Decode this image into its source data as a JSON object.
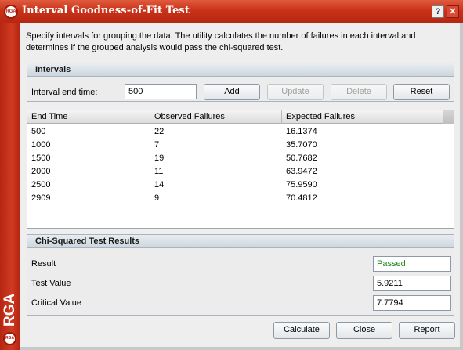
{
  "window": {
    "title": "Interval Goodness-of-Fit Test",
    "logo_text": "RGA",
    "help_label": "?",
    "close_label": "✕",
    "sidebar_brand": "RGA"
  },
  "description": "Specify intervals for grouping the data. The utility calculates the number of failures in each interval and determines if the grouped analysis would pass the chi-squared test.",
  "intervals": {
    "header": "Intervals",
    "end_time_label": "Interval end time:",
    "end_time_value": "500",
    "buttons": {
      "add": "Add",
      "update": "Update",
      "delete": "Delete",
      "reset": "Reset"
    }
  },
  "table": {
    "columns": [
      "End Time",
      "Observed Failures",
      "Expected Failures"
    ],
    "rows": [
      [
        "500",
        "22",
        "16.1374"
      ],
      [
        "1000",
        "7",
        "35.7070"
      ],
      [
        "1500",
        "19",
        "50.7682"
      ],
      [
        "2000",
        "11",
        "63.9472"
      ],
      [
        "2500",
        "14",
        "75.9590"
      ],
      [
        "2909",
        "9",
        "70.4812"
      ]
    ]
  },
  "chi_squared": {
    "header": "Chi-Squared Test Results",
    "result_label": "Result",
    "result_value": "Passed",
    "test_value_label": "Test Value",
    "test_value": "5.9211",
    "critical_value_label": "Critical Value",
    "critical_value": "7.7794"
  },
  "footer": {
    "calculate": "Calculate",
    "close": "Close",
    "report": "Report"
  },
  "colors": {
    "brand_red": "#c93218",
    "passed_green": "#1c8a1c"
  }
}
